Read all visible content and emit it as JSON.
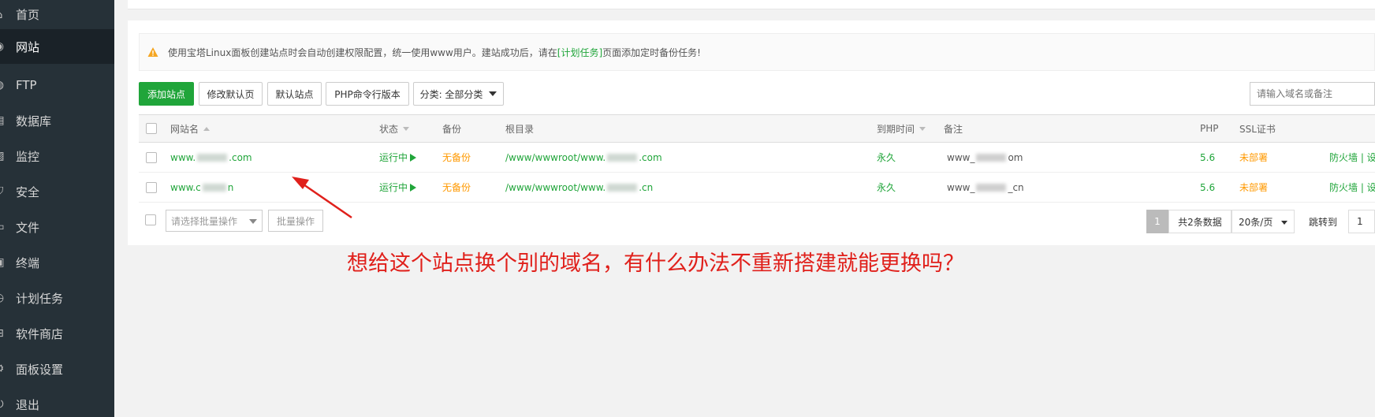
{
  "sidebar": {
    "items": [
      {
        "label": "首页",
        "icon": "home-icon",
        "glyph": "⌂"
      },
      {
        "label": "网站",
        "icon": "globe-icon",
        "glyph": "◉",
        "active": true
      },
      {
        "label": "FTP",
        "icon": "ftp-icon",
        "glyph": "◍"
      },
      {
        "label": "数据库",
        "icon": "database-icon",
        "glyph": "▤"
      },
      {
        "label": "监控",
        "icon": "monitor-icon",
        "glyph": "▨"
      },
      {
        "label": "安全",
        "icon": "shield-icon",
        "glyph": "⛉"
      },
      {
        "label": "文件",
        "icon": "folder-icon",
        "glyph": "▭"
      },
      {
        "label": "终端",
        "icon": "terminal-icon",
        "glyph": "▣"
      },
      {
        "label": "计划任务",
        "icon": "clock-icon",
        "glyph": "◷"
      },
      {
        "label": "软件商店",
        "icon": "grid-icon",
        "glyph": "⊞"
      },
      {
        "label": "面板设置",
        "icon": "gear-icon",
        "glyph": "⚙"
      },
      {
        "label": "退出",
        "icon": "logout-icon",
        "glyph": "⏻"
      }
    ]
  },
  "notice": {
    "text_before": "使用宝塔Linux面板创建站点时会自动创建权限配置，统一使用www用户。建站成功后，请在",
    "link": "[计划任务]",
    "text_after": "页面添加定时备份任务!"
  },
  "toolbar": {
    "add_site": "添加站点",
    "edit_default_page": "修改默认页",
    "default_site": "默认站点",
    "php_cli_version": "PHP命令行版本",
    "category": "分类: 全部分类",
    "search_placeholder": "请输入域名或备注"
  },
  "table": {
    "headers": {
      "site_name": "网站名",
      "status": "状态",
      "backup": "备份",
      "root": "根目录",
      "expire": "到期时间",
      "remark": "备注",
      "php": "PHP",
      "ssl": "SSL证书"
    },
    "rows": [
      {
        "name_prefix": "www.",
        "name_suffix": ".com",
        "status": "运行中",
        "backup": "无备份",
        "root_prefix": "/www/wwwroot/www.",
        "root_suffix": ".com",
        "expire": "永久",
        "remark_prefix": "www_",
        "remark_suffix": "om",
        "php": "5.6",
        "ssl": "未部署",
        "action": "防火墙 | 设"
      },
      {
        "name_prefix": "www.c",
        "name_suffix": "n",
        "status": "运行中",
        "backup": "无备份",
        "root_prefix": "/www/wwwroot/www.",
        "root_suffix": ".cn",
        "expire": "永久",
        "remark_prefix": "www_",
        "remark_suffix": "_cn",
        "php": "5.6",
        "ssl": "未部署",
        "action": "防火墙 | 设"
      }
    ]
  },
  "footer": {
    "batch_select_placeholder": "请选择批量操作",
    "batch_button": "批量操作",
    "page_current": "1",
    "page_total": "共2条数据",
    "page_size": "20条/页",
    "jump_label": "跳转到",
    "jump_value": "1"
  },
  "annotation": "想给这个站点换个别的域名，有什么办法不重新搭建就能更换吗？",
  "colors": {
    "sidebar_bg": "#263138",
    "accent_green": "#20a53a",
    "warning_orange": "#ff9900",
    "annotation_red": "#e0201b"
  }
}
